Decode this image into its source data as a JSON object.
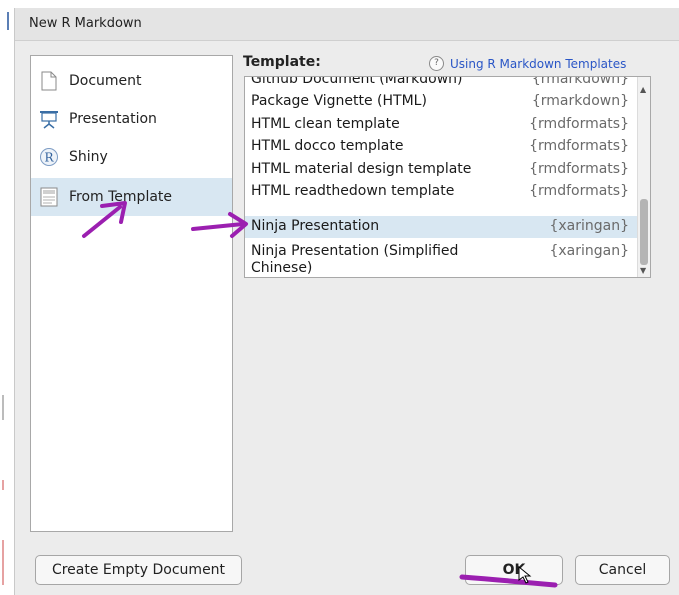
{
  "window": {
    "title": "New R Markdown"
  },
  "formats": [
    {
      "label": "Document",
      "icon": "document-icon"
    },
    {
      "label": "Presentation",
      "icon": "presentation-icon"
    },
    {
      "label": "Shiny",
      "icon": "r-shiny-icon"
    },
    {
      "label": "From Template",
      "icon": "template-icon",
      "selected": true
    }
  ],
  "template": {
    "label": "Template:",
    "help_link": "Using R Markdown Templates",
    "help_icon": "?",
    "items": [
      {
        "name": "Github Document (Markdown)",
        "package": "{rmarkdown}"
      },
      {
        "name": "Package Vignette (HTML)",
        "package": "{rmarkdown}"
      },
      {
        "name": "HTML clean template",
        "package": "{rmdformats}"
      },
      {
        "name": "HTML docco template",
        "package": "{rmdformats}"
      },
      {
        "name": "HTML material design template",
        "package": "{rmdformats}"
      },
      {
        "name": "HTML readthedown template",
        "package": "{rmdformats}"
      },
      {
        "name": "Ninja Presentation",
        "package": "{xaringan}",
        "selected": true
      },
      {
        "name": "Ninja Presentation (Simplified Chinese)",
        "package": "{xaringan}"
      }
    ]
  },
  "buttons": {
    "create_empty": "Create Empty Document",
    "ok": "OK",
    "cancel": "Cancel"
  },
  "colors": {
    "selection": "#d8e7f2",
    "annotation": "#9b1fb0",
    "link": "#2a56c6"
  }
}
